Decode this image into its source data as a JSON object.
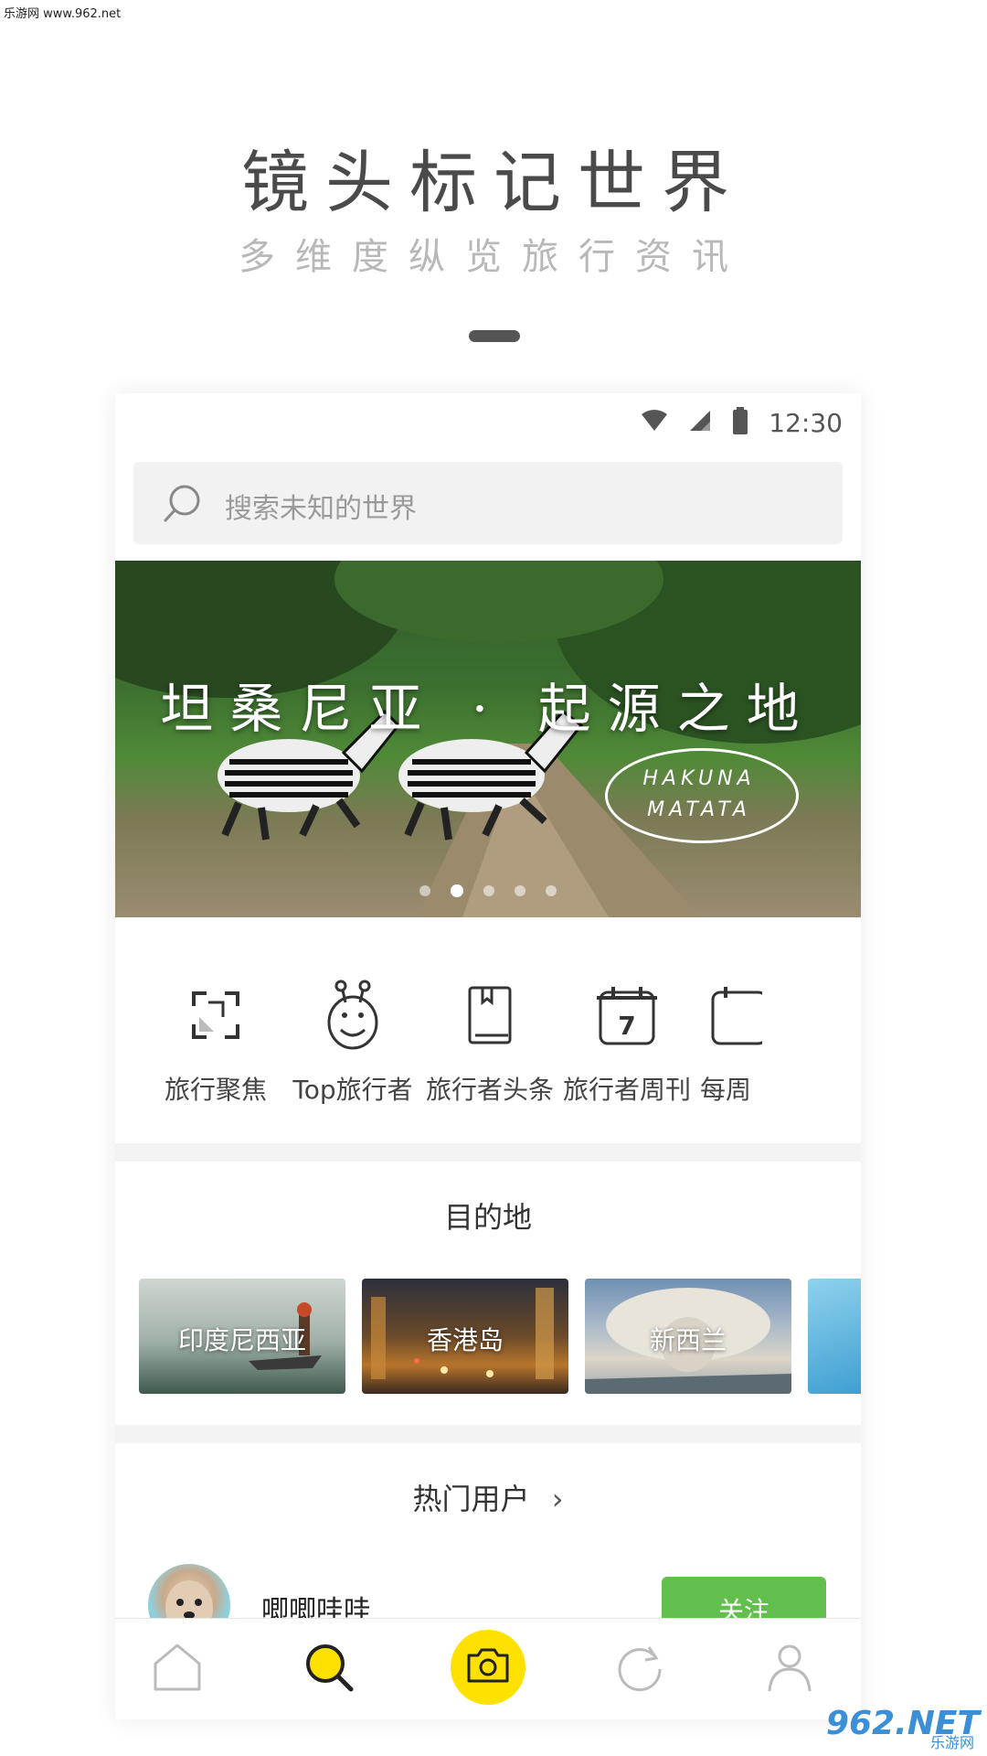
{
  "watermark_top": "乐游网 www.962.net",
  "promo": {
    "headline": "镜头标记世界",
    "subline": "多维度纵览旅行资讯"
  },
  "status_bar": {
    "time": "12:30"
  },
  "search": {
    "placeholder": "搜索未知的世界"
  },
  "banner": {
    "title": "坦桑尼亚 · 起源之地",
    "bubble_line1": "HAKUNA",
    "bubble_line2": "MATATA",
    "page_count": 5,
    "active_page": 2
  },
  "categories": [
    {
      "label": "旅行聚焦",
      "icon": "focus-frame-icon"
    },
    {
      "label": "Top旅行者",
      "icon": "giraffe-icon"
    },
    {
      "label": "旅行者头条",
      "icon": "book-icon"
    },
    {
      "label": "旅行者周刊",
      "icon": "calendar-7-icon"
    },
    {
      "label": "每周",
      "icon": "calendar-icon"
    }
  ],
  "destinations": {
    "title": "目的地",
    "items": [
      {
        "name": "印度尼西亚"
      },
      {
        "name": "香港岛"
      },
      {
        "name": "新西兰"
      }
    ]
  },
  "hot_users": {
    "title": "热门用户",
    "chevron": "›",
    "users": [
      {
        "name": "唧唧哇哇",
        "follow_label": "关注"
      }
    ]
  },
  "tabbar": {
    "tabs": [
      {
        "icon": "home-icon"
      },
      {
        "icon": "search-icon",
        "active": true
      },
      {
        "icon": "camera-icon"
      },
      {
        "icon": "refresh-icon"
      },
      {
        "icon": "profile-icon"
      }
    ]
  },
  "watermark_bottom": {
    "big": "962.NET",
    "small": "乐游网"
  },
  "colors": {
    "accent_yellow": "#ffe100",
    "follow_green": "#62bf4e"
  }
}
